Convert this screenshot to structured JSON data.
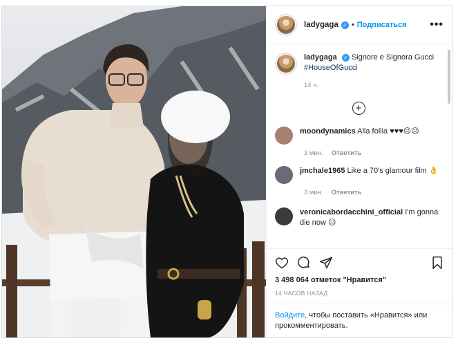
{
  "post": {
    "username": "ladygaga",
    "follow_label": "Подписаться",
    "dot": "•",
    "more_icon": "•••",
    "caption_user": "ladygaga",
    "caption_text": "Signore e Signora Gucci",
    "caption_tag": "#HouseOfGucci",
    "caption_time": "14 ч.",
    "likes": "3 498 064 отметок \"Нравится\"",
    "posted_ago": "14 ЧАСОВ НАЗАД",
    "login_link": "Войдите",
    "login_text": ", чтобы поставить «Нравится» или прокомментировать."
  },
  "comments": [
    {
      "user": "moondynamics",
      "text": "Alla follia ♥♥♥☹☹",
      "time": "3 мин.",
      "reply": "Ответить",
      "avatar_color": "#a77f6e"
    },
    {
      "user": "jmchale1965",
      "text": "Like a 70's glamour film 👌",
      "time": "3 мин.",
      "reply": "Ответить",
      "avatar_color": "#6a6a7a"
    },
    {
      "user": "veronicabordacchini_official",
      "text": "I'm gonna die now ☹",
      "time": "",
      "reply": "",
      "avatar_color": "#3b3b3b"
    }
  ],
  "icons": {
    "verified": "✓",
    "plus": "+"
  }
}
